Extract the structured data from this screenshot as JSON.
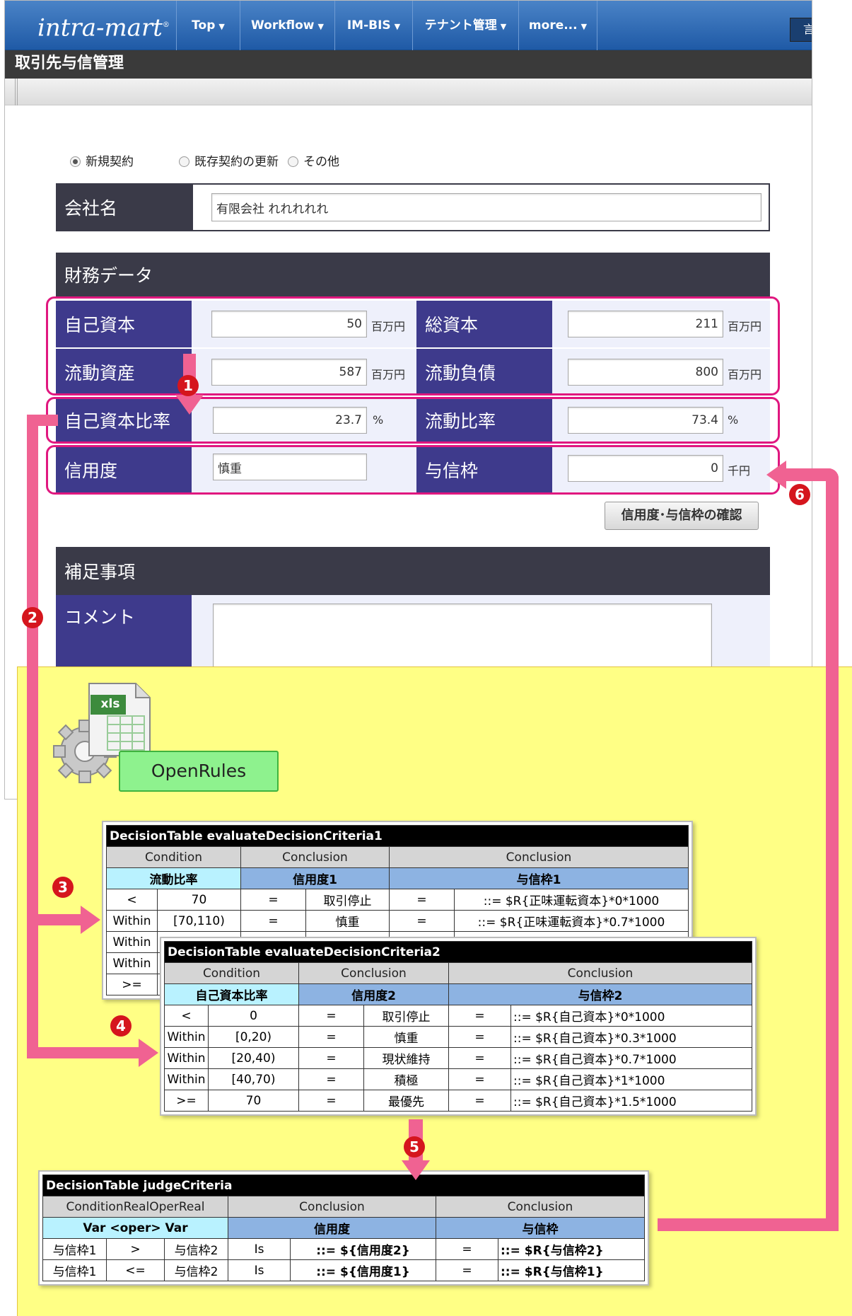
{
  "nav": {
    "logo": "intra-mart",
    "logo_mark": "®",
    "items": [
      "Top",
      "Workflow",
      "IM-BIS",
      "テナント管理",
      "more..."
    ],
    "lang_button": "言"
  },
  "page_title": "取引先与信管理",
  "radios": [
    {
      "label": "新規契約",
      "checked": true
    },
    {
      "label": "既存契約の更新",
      "checked": false
    },
    {
      "label": "その他",
      "checked": false
    }
  ],
  "company": {
    "label": "会社名",
    "value": "有限会社 れれれれれ"
  },
  "finance": {
    "section": "財務データ",
    "equity": {
      "label": "自己資本",
      "value": "50",
      "unit": "百万円"
    },
    "total_capital": {
      "label": "総資本",
      "value": "211",
      "unit": "百万円"
    },
    "current_assets": {
      "label": "流動資産",
      "value": "587",
      "unit": "百万円"
    },
    "current_liabilities": {
      "label": "流動負債",
      "value": "800",
      "unit": "百万円"
    },
    "equity_ratio": {
      "label": "自己資本比率",
      "value": "23.7",
      "unit": "%"
    },
    "current_ratio": {
      "label": "流動比率",
      "value": "73.4",
      "unit": "%"
    },
    "credit_rating": {
      "label": "信用度",
      "value": "慎重"
    },
    "credit_limit": {
      "label": "与信枠",
      "value": "0",
      "unit": "千円"
    },
    "check_button": "信用度･与信枠の確認"
  },
  "notes": {
    "section": "補足事項",
    "comment_label": "コメント",
    "comment_value": ""
  },
  "rules_engine": {
    "file_badge": "xls",
    "name": "OpenRules"
  },
  "badges": [
    "1",
    "2",
    "3",
    "4",
    "5",
    "6"
  ],
  "table1": {
    "title": "DecisionTable evaluateDecisionCriteria1",
    "headers": [
      "Condition",
      "Conclusion",
      "Conclusion"
    ],
    "subheaders": [
      "流動比率",
      "信用度1",
      "与信枠1"
    ],
    "rows": [
      [
        "<",
        "70",
        "=",
        "取引停止",
        "=",
        "::= $R{正味運転資本}*0*1000"
      ],
      [
        "Within",
        "[70,110)",
        "=",
        "慎重",
        "=",
        "::= $R{正味運転資本}*0.7*1000"
      ],
      [
        "Within",
        "",
        "",
        "",
        "",
        ""
      ],
      [
        "Within",
        "",
        "",
        "",
        "",
        ""
      ],
      [
        ">=",
        "",
        "",
        "",
        "",
        ""
      ]
    ]
  },
  "table2": {
    "title": "DecisionTable evaluateDecisionCriteria2",
    "headers": [
      "Condition",
      "Conclusion",
      "Conclusion"
    ],
    "subheaders": [
      "自己資本比率",
      "信用度2",
      "与信枠2"
    ],
    "rows": [
      [
        "<",
        "0",
        "=",
        "取引停止",
        "=",
        "::= $R{自己資本}*0*1000"
      ],
      [
        "Within",
        "[0,20)",
        "=",
        "慎重",
        "=",
        "::= $R{自己資本}*0.3*1000"
      ],
      [
        "Within",
        "[20,40)",
        "=",
        "現状維持",
        "=",
        "::= $R{自己資本}*0.7*1000"
      ],
      [
        "Within",
        "[40,70)",
        "=",
        "積極",
        "=",
        "::= $R{自己資本}*1*1000"
      ],
      [
        ">=",
        "70",
        "=",
        "最優先",
        "=",
        "::= $R{自己資本}*1.5*1000"
      ]
    ]
  },
  "table3": {
    "title": "DecisionTable judgeCriteria",
    "headers": [
      "ConditionRealOperReal",
      "Conclusion",
      "Conclusion"
    ],
    "subheaders": [
      "Var <oper> Var",
      "信用度",
      "与信枠"
    ],
    "rows": [
      [
        "与信枠1",
        ">",
        "与信枠2",
        "Is",
        "::= ${信用度2}",
        "=",
        "::= $R{与信枠2}"
      ],
      [
        "与信枠1",
        "<=",
        "与信枠2",
        "Is",
        "::= ${信用度1}",
        "=",
        "::= $R{与信枠1}"
      ]
    ]
  }
}
